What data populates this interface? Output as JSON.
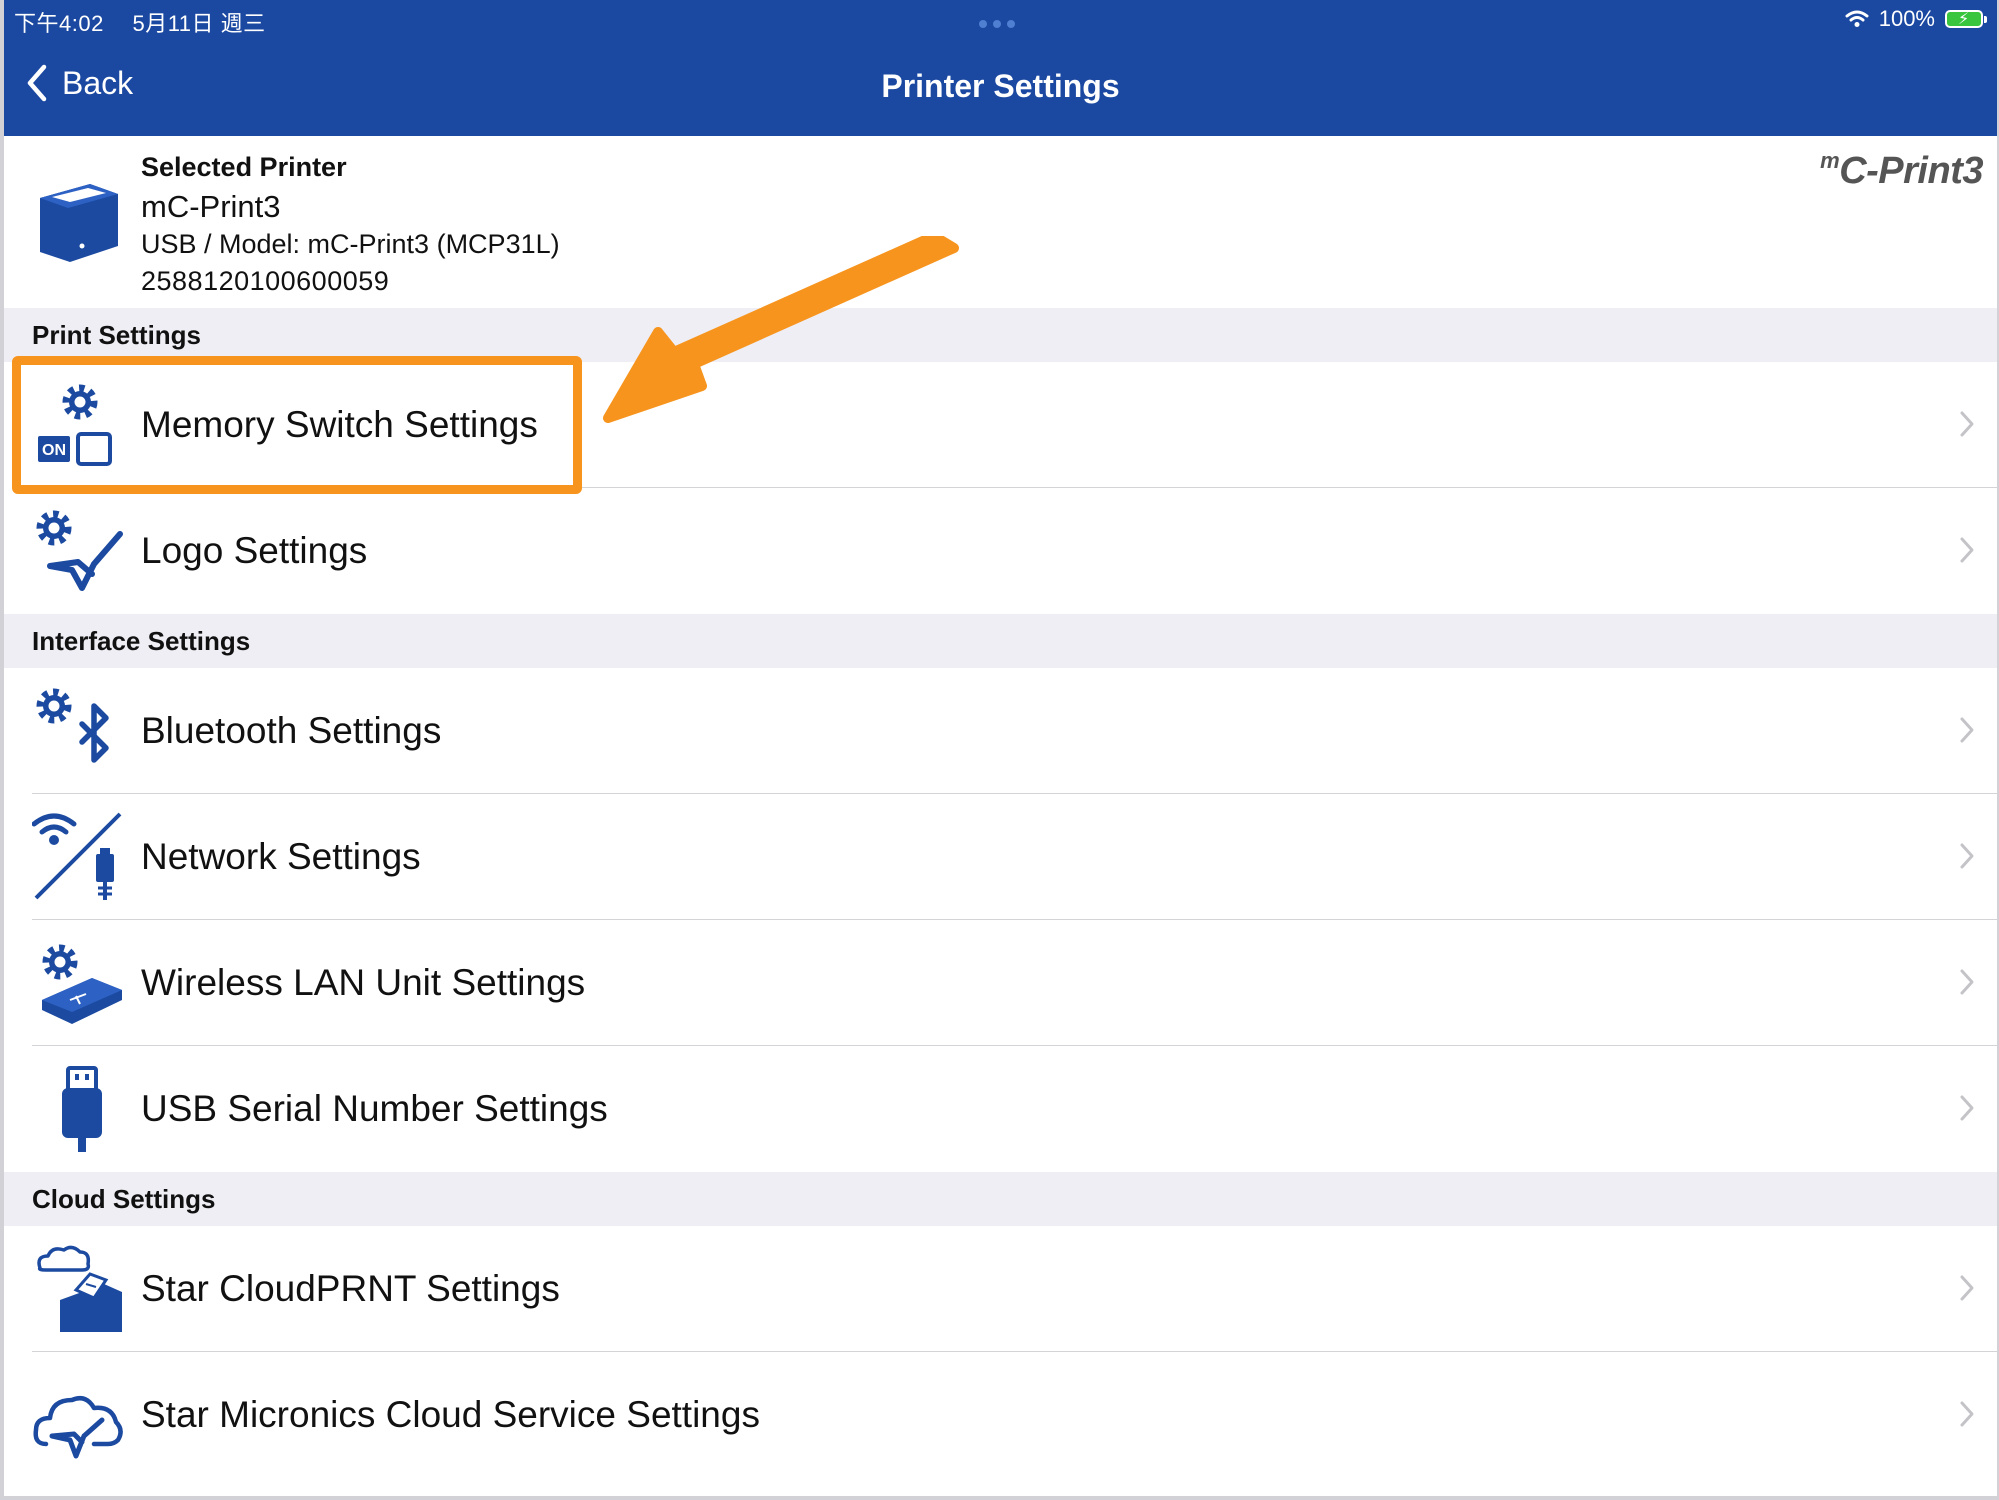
{
  "status_bar": {
    "time": "下午4:02",
    "date": "5月11日 週三",
    "battery": "100%"
  },
  "nav": {
    "back_label": "Back",
    "title": "Printer Settings"
  },
  "printer": {
    "label": "Selected Printer",
    "name": "mC-Print3",
    "model": "USB / Model: mC-Print3 (MCP31L)",
    "serial": "2588120100600059",
    "brand_logo_text": "C-Print3",
    "brand_logo_prefix": "m"
  },
  "sections": {
    "print": "Print Settings",
    "interface": "Interface Settings",
    "cloud": "Cloud Settings"
  },
  "rows": {
    "memory_switch": "Memory Switch Settings",
    "logo": "Logo Settings",
    "bluetooth": "Bluetooth Settings",
    "network": "Network Settings",
    "wlan_unit": "Wireless LAN Unit Settings",
    "usb_serial": "USB Serial Number Settings",
    "cloudprnt": "Star CloudPRNT Settings",
    "micronics_cloud": "Star Micronics Cloud Service Settings"
  },
  "on_badge": "ON",
  "colors": {
    "nav_bg": "#1b48a1",
    "icon_blue": "#1b4aa0",
    "highlight": "#f7941d",
    "section_bg": "#eeeef4"
  },
  "icons": {
    "back": "chevron-left-icon",
    "printer": "printer-icon",
    "memory_switch": "gear-switch-icon",
    "logo": "gear-star-icon",
    "bluetooth": "gear-bluetooth-icon",
    "network": "wifi-ethernet-icon",
    "wlan_unit": "gear-wlan-unit-icon",
    "usb_serial": "usb-icon",
    "cloudprnt": "cloud-printer-icon",
    "micronics_cloud": "cloud-star-icon"
  }
}
